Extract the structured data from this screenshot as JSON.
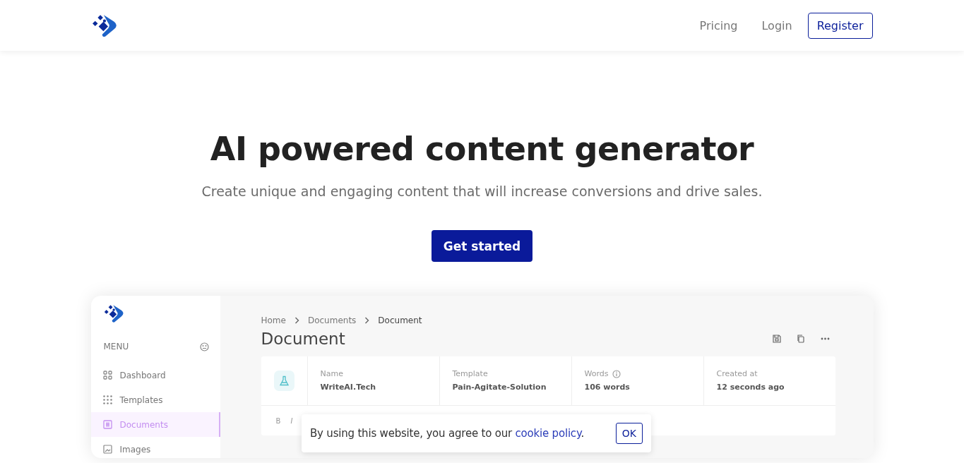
{
  "header": {
    "nav": [
      {
        "label": "Pricing",
        "kind": "link"
      },
      {
        "label": "Login",
        "kind": "link"
      },
      {
        "label": "Register",
        "kind": "button"
      }
    ]
  },
  "hero": {
    "title": "AI powered content generator",
    "subtitle": "Create unique and engaging content that will increase conversions and drive sales.",
    "cta": "Get started"
  },
  "preview": {
    "sidebar": {
      "menu_label": "MENU",
      "items": [
        {
          "label": "Dashboard",
          "selected": false
        },
        {
          "label": "Templates",
          "selected": false
        },
        {
          "label": "Documents",
          "selected": true
        },
        {
          "label": "Images",
          "selected": false
        }
      ]
    },
    "breadcrumb": [
      "Home",
      "Documents",
      "Document"
    ],
    "title": "Document",
    "info": [
      {
        "label": "Name",
        "value": "WriteAI.Tech"
      },
      {
        "label": "Template",
        "value": "Pain-Agitate-Solution"
      },
      {
        "label": "Words",
        "value": "106 words"
      },
      {
        "label": "Created at",
        "value": "12 seconds ago"
      }
    ],
    "toolbar": [
      "B",
      "I"
    ]
  },
  "cookie": {
    "text_before": "By using this website, you agree to our ",
    "link": "cookie policy",
    "text_after": ".",
    "button": "OK"
  }
}
